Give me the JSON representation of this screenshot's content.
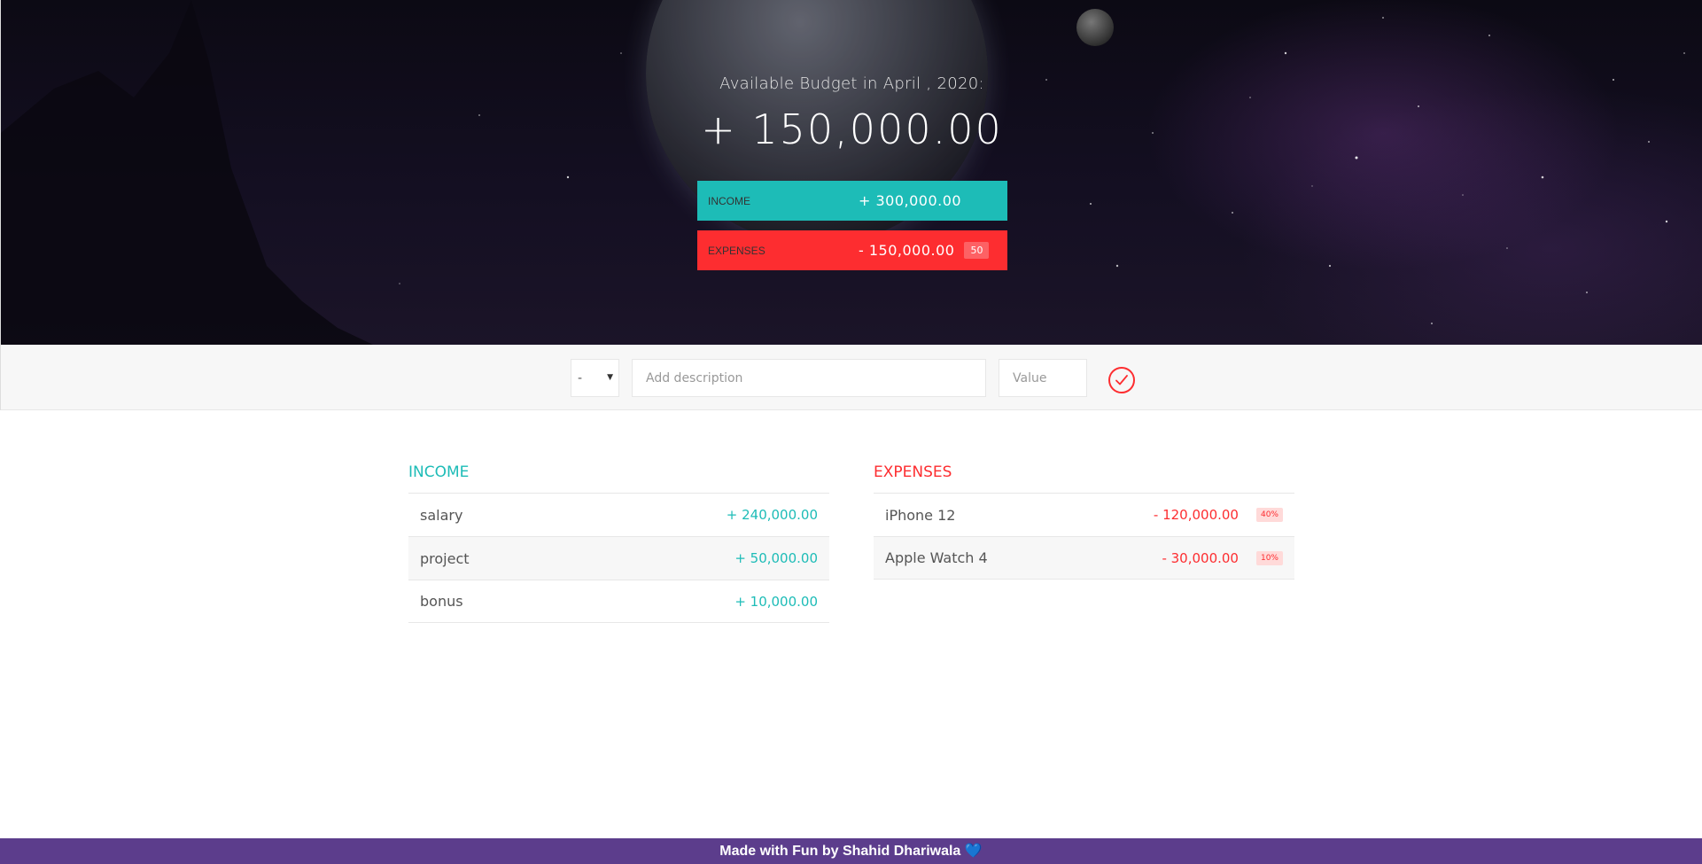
{
  "top": {
    "title": "Available Budget in April , 2020:",
    "value": "+ 150,000.00",
    "income_label": "Income",
    "income_value": "+ 300,000.00",
    "expenses_label": "Expenses",
    "expenses_value": "- 150,000.00",
    "expenses_percentage": "50"
  },
  "add": {
    "type_selected": "-",
    "description_placeholder": "Add description",
    "value_placeholder": "Value"
  },
  "income": {
    "title": "Income",
    "items": [
      {
        "description": "salary",
        "value": "+ 240,000.00"
      },
      {
        "description": "project",
        "value": "+ 50,000.00"
      },
      {
        "description": "bonus",
        "value": "+ 10,000.00"
      }
    ]
  },
  "expenses": {
    "title": "Expenses",
    "items": [
      {
        "description": "iPhone 12",
        "value": "- 120,000.00",
        "percentage": "40%"
      },
      {
        "description": "Apple Watch 4",
        "value": "- 30,000.00",
        "percentage": "10%"
      }
    ]
  },
  "footer": {
    "text": "Made with Fun by Shahid Dhariwala",
    "heart": "💙"
  },
  "colors": {
    "income": "#1dbcb7",
    "expenses": "#fd2d30",
    "footer_bg": "#5c3d8c"
  },
  "icons": {
    "add": "checkmark-circle-icon",
    "select": "chevron-down-icon"
  }
}
